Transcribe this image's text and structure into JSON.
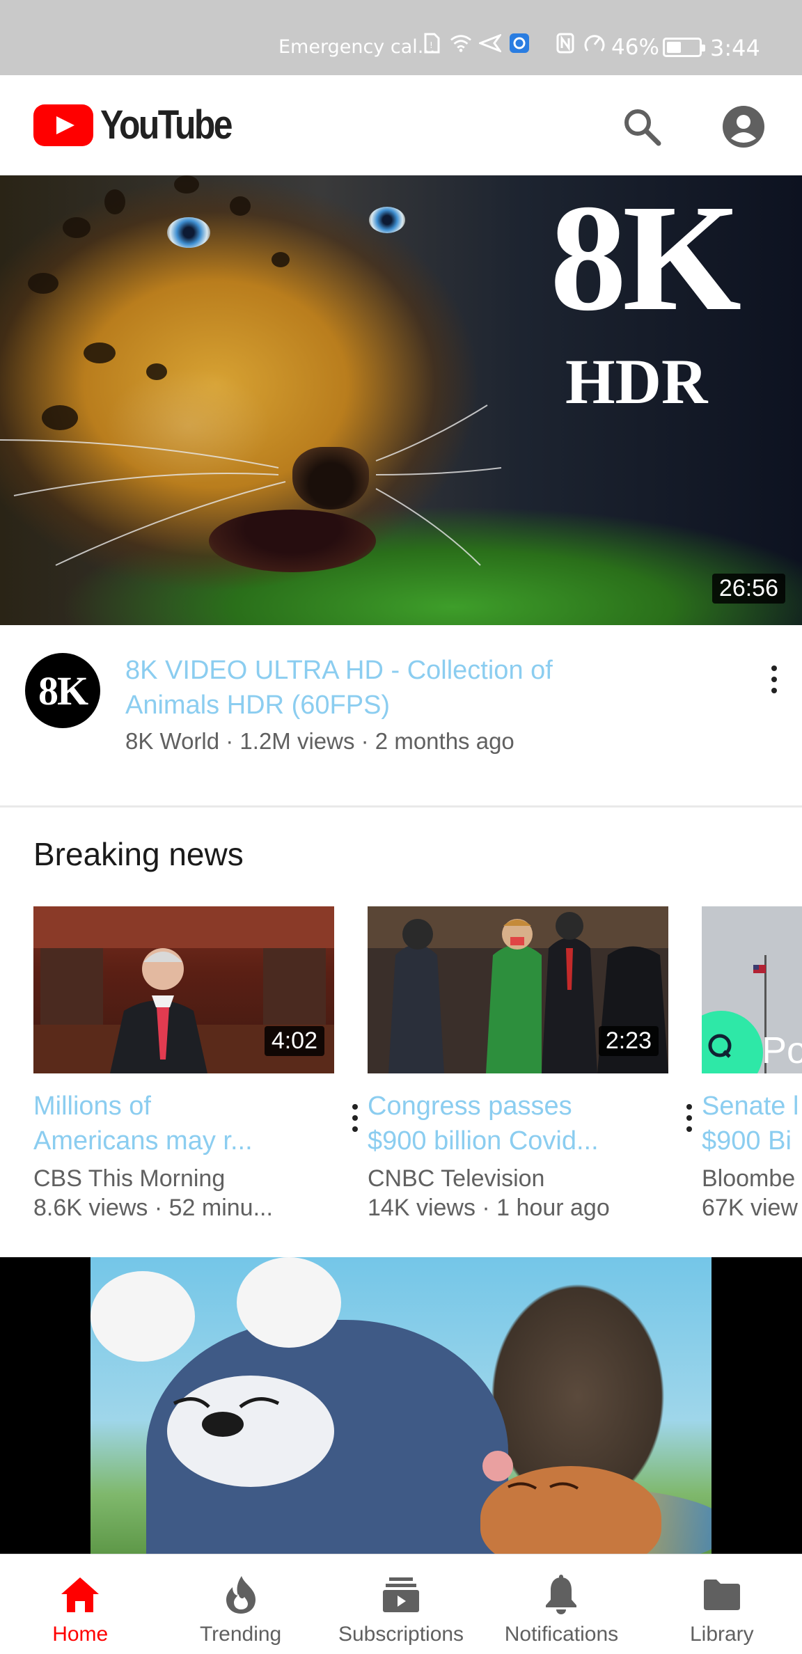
{
  "status_bar": {
    "emergency": "Emergency cal...",
    "battery_percent": "46%",
    "battery_level": 0.46,
    "time": "3:44"
  },
  "header": {
    "logo_text": "YouTube",
    "search_icon": "search-icon",
    "account_icon": "account-circle-icon",
    "brand_color": "#ff0000"
  },
  "featured": {
    "thumb_text_big": "8K",
    "thumb_text_small": "HDR",
    "duration": "26:56",
    "avatar_text": "8K",
    "title": "8K VIDEO ULTRA HD - Collection of Animals HDR (60FPS)",
    "meta": "8K World · 1.2M views · 2 months ago",
    "title_color": "#8bcdf0"
  },
  "shelf": {
    "title": "Breaking news",
    "cards": [
      {
        "duration": "4:02",
        "title_line1": "Millions of",
        "title_line2": "Americans may r...",
        "channel": "CBS This Morning",
        "meta": "8.6K views · 52 minu..."
      },
      {
        "duration": "2:23",
        "title_line1": "Congress passes",
        "title_line2": "$900 billion Covid...",
        "channel": "CNBC Television",
        "meta": "14K views · 1 hour ago"
      },
      {
        "thumb_overlay": "Po",
        "title_line1": "Senate l",
        "title_line2": "$900 Bi",
        "channel": "Bloombe",
        "meta": "67K view"
      }
    ]
  },
  "bottom_nav": {
    "items": [
      {
        "label": "Home",
        "icon": "home-icon",
        "active": true
      },
      {
        "label": "Trending",
        "icon": "trending-flame-icon",
        "active": false
      },
      {
        "label": "Subscriptions",
        "icon": "subscriptions-icon",
        "active": false
      },
      {
        "label": "Notifications",
        "icon": "bell-icon",
        "active": false
      },
      {
        "label": "Library",
        "icon": "folder-icon",
        "active": false
      }
    ]
  }
}
